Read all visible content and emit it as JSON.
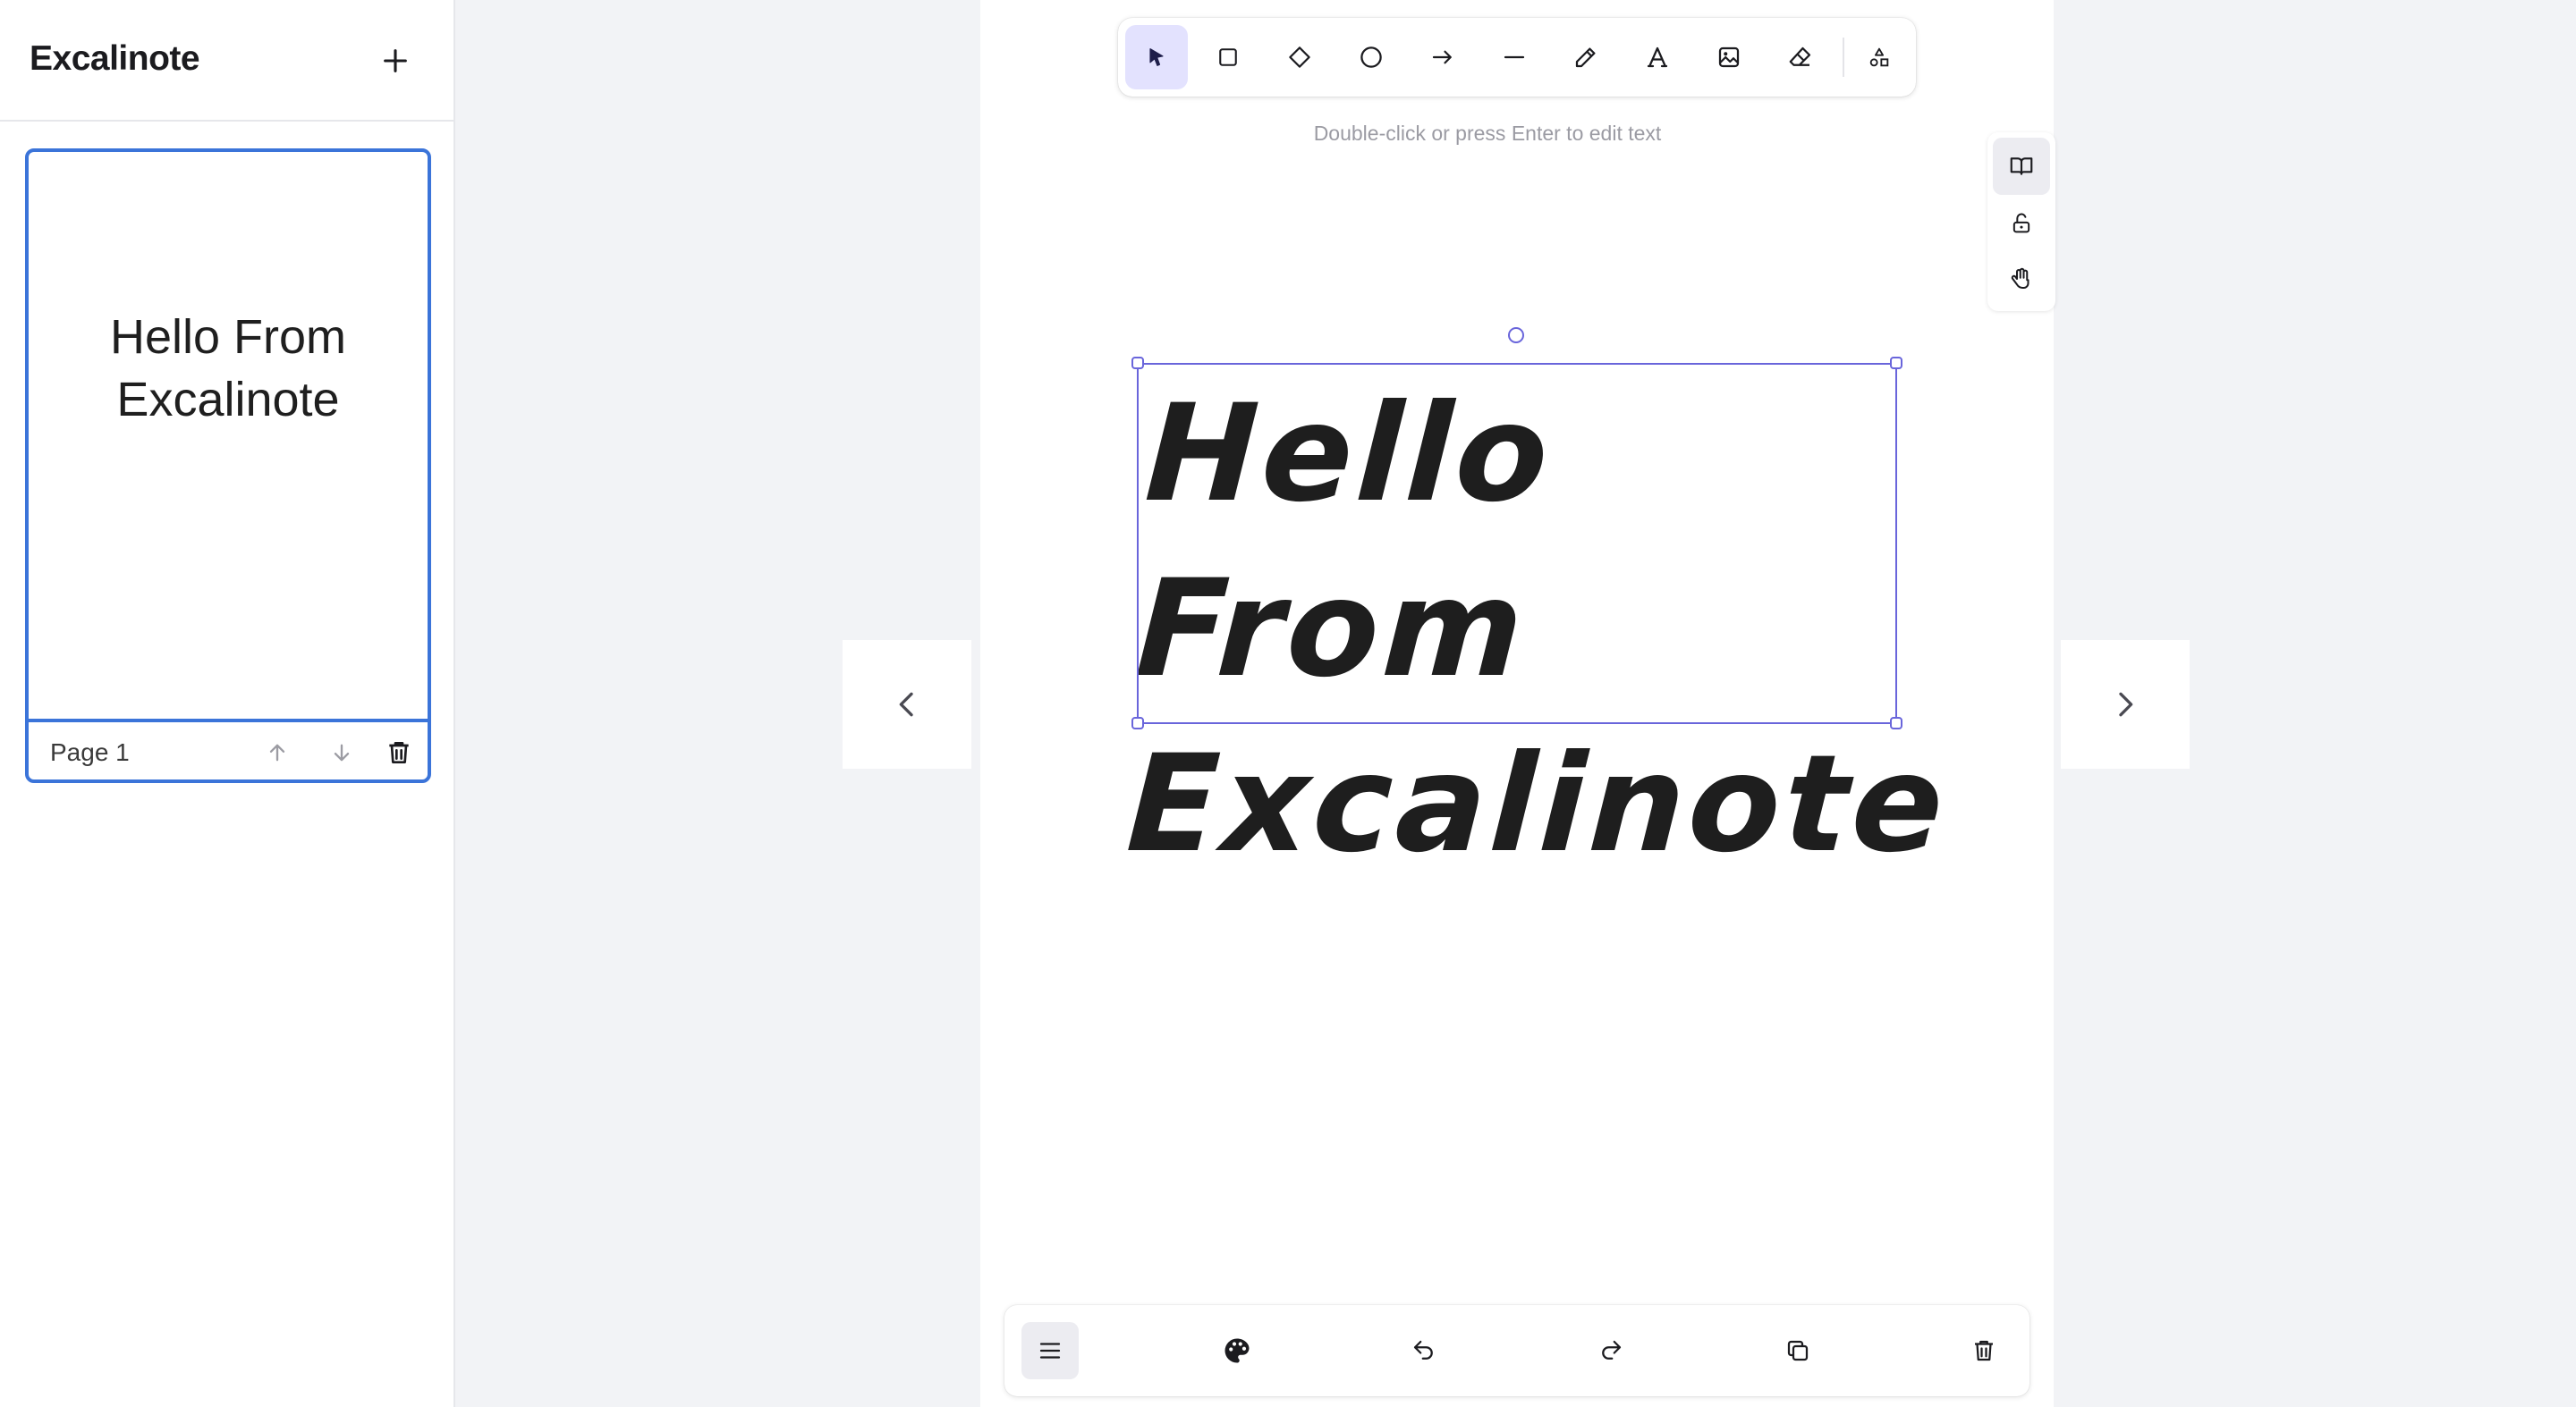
{
  "app": {
    "title": "Excalinote"
  },
  "sidebar": {
    "add_icon": "plus-icon",
    "pages": [
      {
        "label": "Page 1",
        "preview_text": "Hello From Excalinote",
        "selected": true
      }
    ]
  },
  "toolbar": {
    "tools": [
      "selection-icon",
      "rectangle-icon",
      "diamond-icon",
      "ellipse-icon",
      "arrow-icon",
      "line-icon",
      "pencil-icon",
      "text-icon",
      "image-icon",
      "eraser-icon",
      "more-shapes-icon"
    ],
    "active_tool": "selection"
  },
  "canvas": {
    "hint": "Double-click or press Enter to edit text",
    "text_element": "Hello From\nExcalinote",
    "selection_color": "#6965db"
  },
  "side_tools": [
    "read-mode-icon",
    "lock-icon",
    "hand-icon"
  ],
  "bottom_bar": [
    "menu-icon",
    "palette-icon",
    "undo-icon",
    "redo-icon",
    "duplicate-icon",
    "trash-icon"
  ],
  "colors": {
    "accent": "#3b74d9",
    "selection": "#6965db",
    "active_tool_bg": "#e3e2fe"
  }
}
